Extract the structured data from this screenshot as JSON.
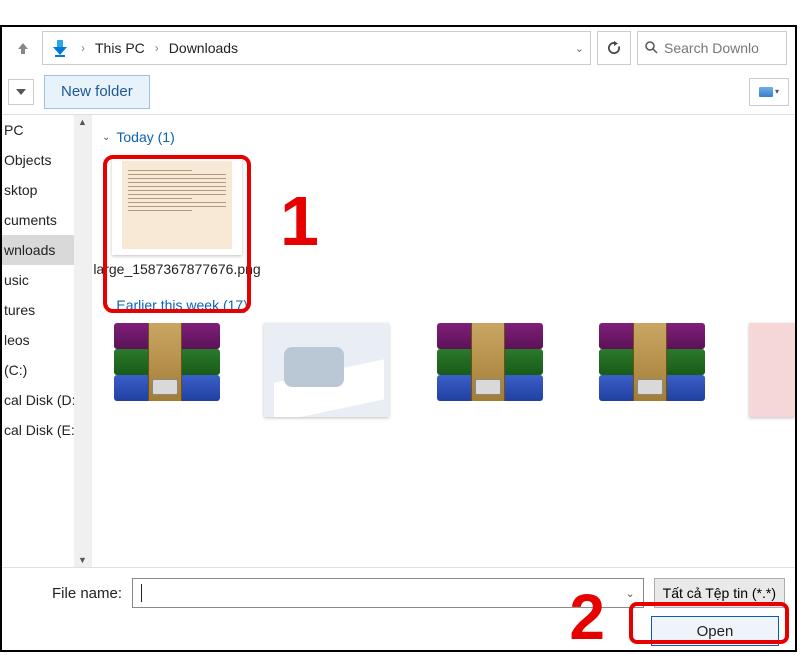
{
  "breadcrumb": {
    "root": "This PC",
    "folder": "Downloads"
  },
  "search": {
    "placeholder": "Search Downlo"
  },
  "toolbar": {
    "new_folder": "New folder"
  },
  "sidebar": {
    "items": [
      {
        "label": "PC"
      },
      {
        "label": "Objects"
      },
      {
        "label": "sktop"
      },
      {
        "label": "cuments"
      },
      {
        "label": "wnloads"
      },
      {
        "label": "usic"
      },
      {
        "label": "tures"
      },
      {
        "label": "leos"
      },
      {
        "label": "(C:)"
      },
      {
        "label": "cal Disk (D:)"
      },
      {
        "label": "cal Disk (E:)"
      }
    ],
    "selected_index": 4
  },
  "groups": {
    "today": {
      "label": "Today (1)"
    },
    "earlier": {
      "label": "Earlier this week (17)"
    }
  },
  "files": {
    "today_file": {
      "name": "large_1587367877676.png"
    }
  },
  "footer": {
    "filename_label": "File name:",
    "filename_value": "",
    "filter_label": "Tất cả Tệp tin (*.*)",
    "open_label": "Open"
  },
  "annotations": {
    "one": "1",
    "two": "2"
  }
}
